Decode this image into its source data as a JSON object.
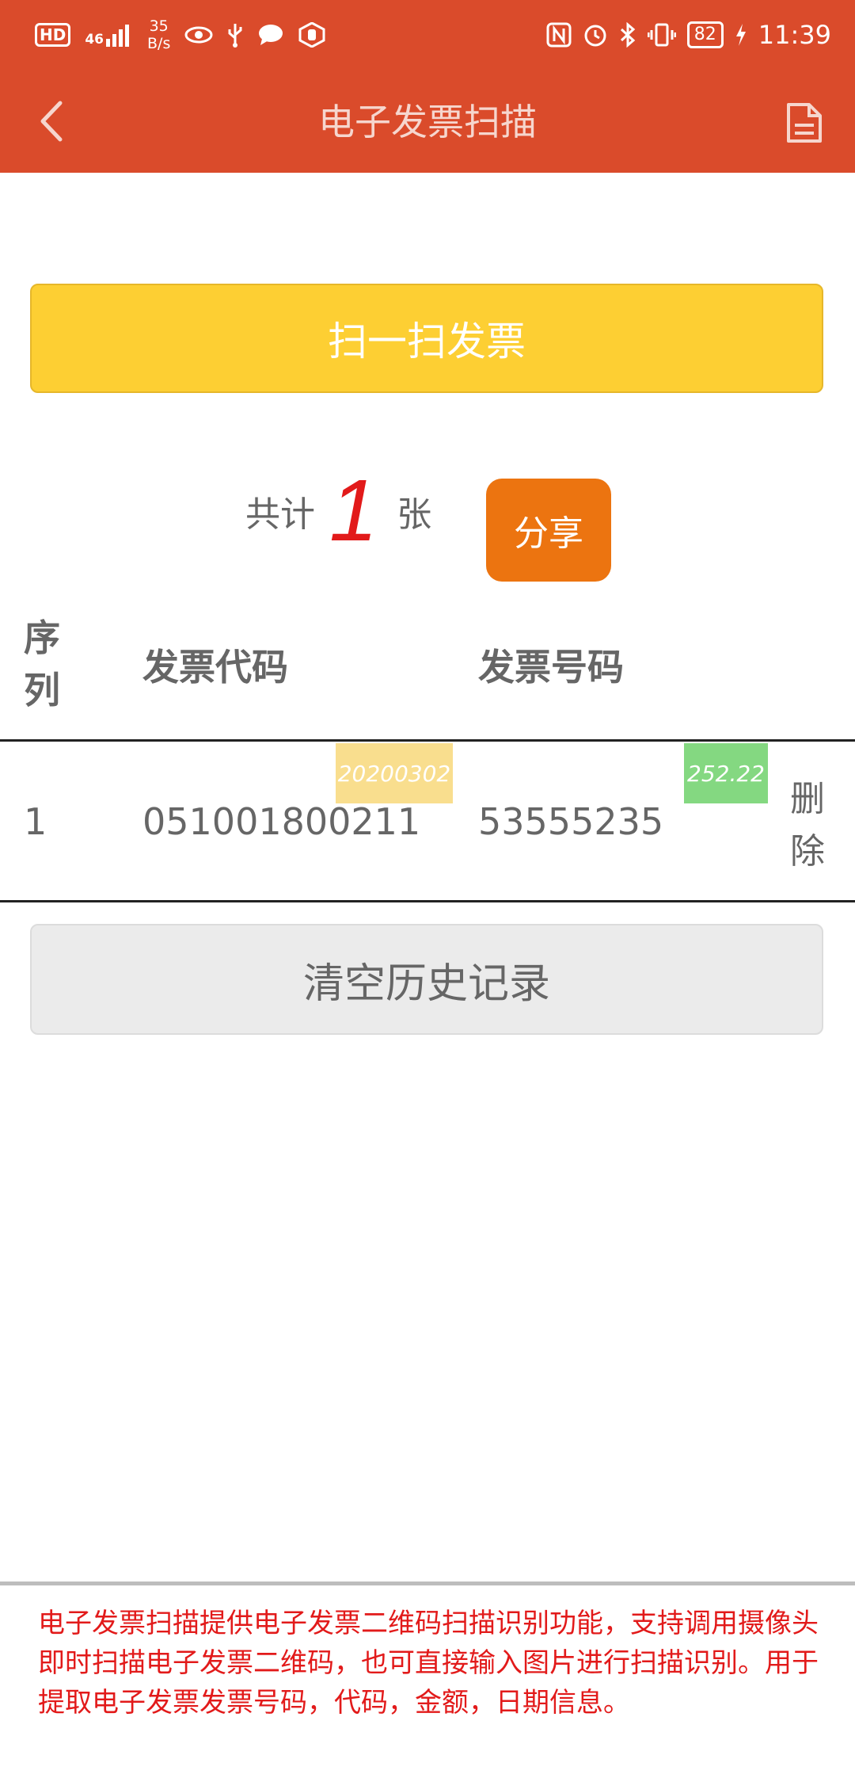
{
  "status_bar": {
    "hd": "HD",
    "signal_label": "46",
    "net_speed": "35",
    "net_unit": "B/s",
    "battery": "82",
    "time": "11:39"
  },
  "app_bar": {
    "title": "电子发票扫描",
    "back_icon": "chevron-left-icon",
    "doc_icon": "document-icon"
  },
  "scan_button": "扫一扫发票",
  "summary": {
    "prefix": "共计",
    "count": "1",
    "suffix": "张"
  },
  "share_button": "分享",
  "table": {
    "headers": {
      "seq": "序列",
      "code": "发票代码",
      "number": "发票号码"
    },
    "rows": [
      {
        "seq": "1",
        "code": "051001800211",
        "date": "20200302",
        "number": "53555235",
        "amount": "252.22",
        "delete": "删除"
      }
    ]
  },
  "clear_button": "清空历史记录",
  "footer": "电子发票扫描提供电子发票二维码扫描识别功能，支持调用摄像头即时扫描电子发票二维码，也可直接输入图片进行扫描识别。用于提取电子发票发票号码，代码，金额，日期信息。",
  "colors": {
    "header": "#da4b2b",
    "scan": "#fdcf33",
    "share": "#ec7410",
    "count": "#e21a1a",
    "date_tag": "#f9de8e",
    "amount_tag": "#84d881"
  }
}
